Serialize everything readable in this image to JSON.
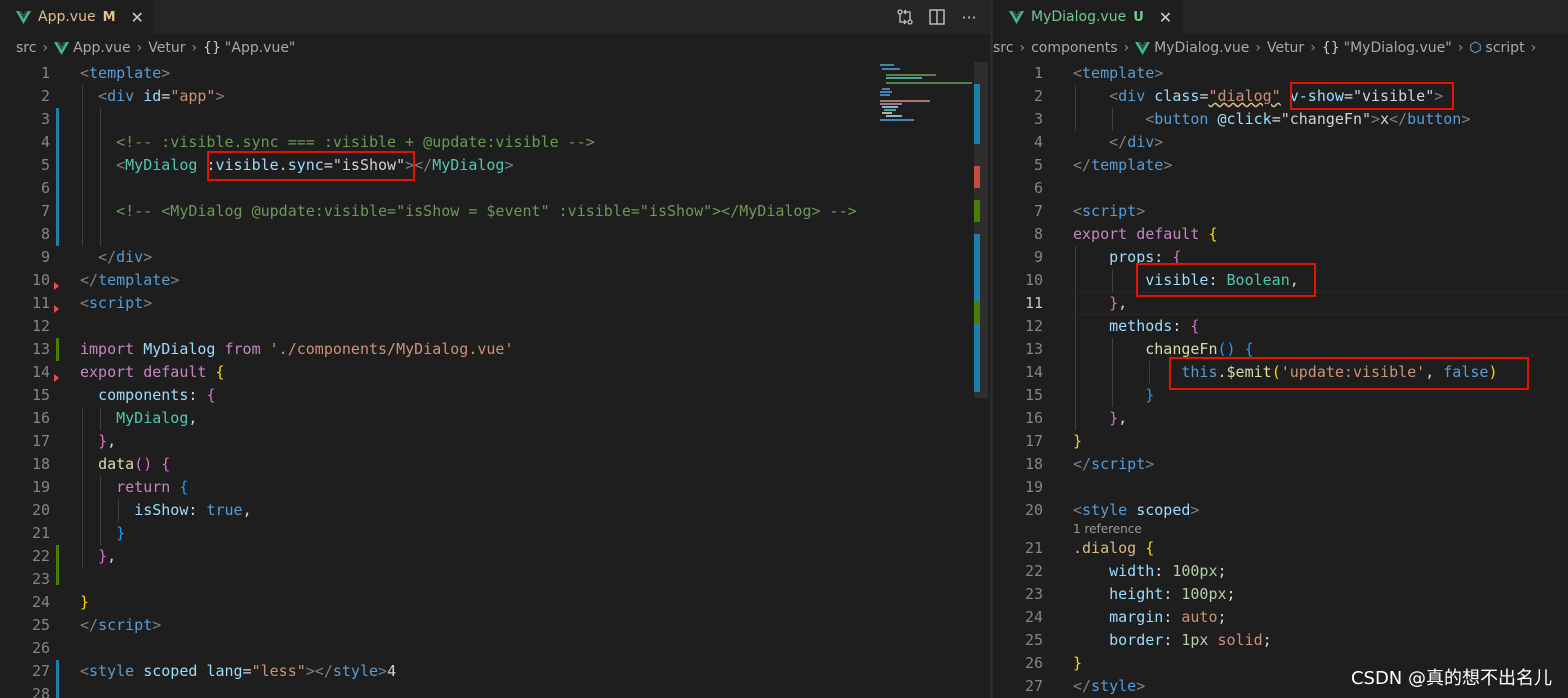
{
  "left": {
    "tab": {
      "name": "App.vue",
      "status": "M"
    },
    "breadcrumb": {
      "folder": "src",
      "file": "App.vue",
      "lang": "Vetur",
      "symbol": "\"App.vue\""
    },
    "line_numbers": [
      "1",
      "2",
      "3",
      "4",
      "5",
      "6",
      "7",
      "8",
      "9",
      "10",
      "11",
      "12",
      "13",
      "14",
      "15",
      "16",
      "17",
      "18",
      "19",
      "20",
      "21",
      "22",
      "23",
      "24",
      "25",
      "26",
      "27",
      "28"
    ]
  },
  "right": {
    "tab": {
      "name": "MyDialog.vue",
      "status": "U"
    },
    "breadcrumb": {
      "folder": "src",
      "sub": "components",
      "file": "MyDialog.vue",
      "lang": "Vetur",
      "symbol": "\"MyDialog.vue\"",
      "section": "script"
    },
    "line_numbers": [
      "1",
      "2",
      "3",
      "4",
      "5",
      "6",
      "7",
      "8",
      "9",
      "10",
      "11",
      "12",
      "13",
      "14",
      "15",
      "16",
      "17",
      "18",
      "19",
      "20",
      "21",
      "22",
      "23",
      "24",
      "25",
      "26",
      "27"
    ],
    "codelens": "1 reference"
  },
  "tokens": {
    "template": "template",
    "div": "div",
    "id": "id",
    "eq": "=",
    "app_str": "\"app\"",
    "comment1": "<!-- :visible.sync === :visible + @update:visible -->",
    "mydialog": "MyDialog",
    "sync_attr": ":visible.sync",
    "isshow_str": "\"isShow\"",
    "comment2": "<!-- <MyDialog @update:visible=\"isShow = $event\" :visible=\"isShow\"></MyDialog> -->",
    "script": "script",
    "import": "import",
    "from": "from",
    "path_str": "'./components/MyDialog.vue'",
    "export": "export",
    "default": "default",
    "components": "components",
    "data": "data",
    "return": "return",
    "isshow": "isShow",
    "true": "true",
    "style": "style",
    "scoped": "scoped",
    "lang": "lang",
    "less_str": "\"less\"",
    "trailing4": "4",
    "class": "class",
    "dialog_str": "\"dialog\"",
    "vshow": "v-show",
    "visible_str": "\"visible\"",
    "button": "button",
    "click": "@click",
    "changefn_str": "\"changeFn\"",
    "x": "x",
    "props": "props",
    "visible": "visible",
    "boolean": "Boolean",
    "methods": "methods",
    "changefn": "changeFn",
    "this": "this",
    "emit": "$emit",
    "update_str": "'update:visible'",
    "false": "false",
    "dialog_sel": ".dialog",
    "width": "width",
    "height": "height",
    "margin": "margin",
    "border": "border",
    "v100": "100px",
    "auto": "auto",
    "v1px": "1px",
    "solid": "solid"
  },
  "watermark": "CSDN @真的想不出名儿",
  "colors": {
    "editor_bg": "#1e1e1e",
    "tab_modified": "#e2c08d",
    "highlight_box": "#e51400",
    "git_modified": "#1b81a8",
    "git_added": "#487e02",
    "git_deleted": "#f14c4c"
  },
  "icons": [
    "vue-file-icon",
    "close-icon",
    "git-compare-icon",
    "split-editor-icon",
    "more-actions-icon",
    "chevron-right-icon",
    "braces-icon",
    "symbol-method-icon"
  ]
}
